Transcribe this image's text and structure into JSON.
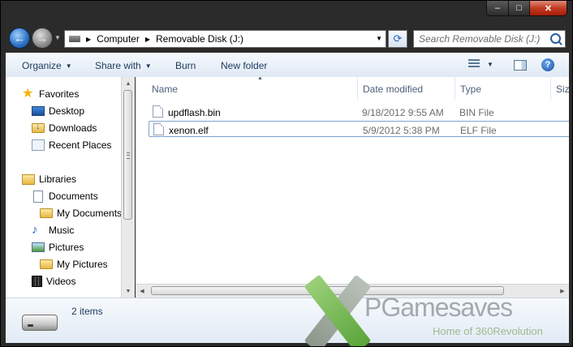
{
  "window": {
    "caption": {
      "minimize": "–",
      "maximize": "□",
      "close": "✕"
    }
  },
  "address_bar": {
    "crumbs": [
      "Computer",
      "Removable Disk (J:)"
    ]
  },
  "search": {
    "placeholder": "Search Removable Disk (J:)"
  },
  "toolbar": {
    "organize": "Organize",
    "share_with": "Share with",
    "burn": "Burn",
    "new_folder": "New folder"
  },
  "nav_pane": {
    "favorites": {
      "label": "Favorites",
      "items": [
        "Desktop",
        "Downloads",
        "Recent Places"
      ]
    },
    "libraries": {
      "label": "Libraries",
      "items": [
        "Documents",
        "My Documents",
        "Music",
        "Pictures",
        "My Pictures",
        "Videos"
      ]
    }
  },
  "columns": {
    "name": "Name",
    "date_modified": "Date modified",
    "type": "Type",
    "size": "Size"
  },
  "files": [
    {
      "name": "updflash.bin",
      "date": "9/18/2012 9:55 AM",
      "type": "BIN File"
    },
    {
      "name": "xenon.elf",
      "date": "5/9/2012 5:38 PM",
      "type": "ELF File"
    }
  ],
  "details": {
    "item_count": "2 items"
  },
  "watermark": {
    "title": "PGamesaves",
    "subtitle": "Home of 360Revolution"
  },
  "colors": {
    "frame": "#2b2b2b",
    "close": "#c23c22",
    "selection_border": "#7da2ce",
    "text": "#1e395b"
  }
}
